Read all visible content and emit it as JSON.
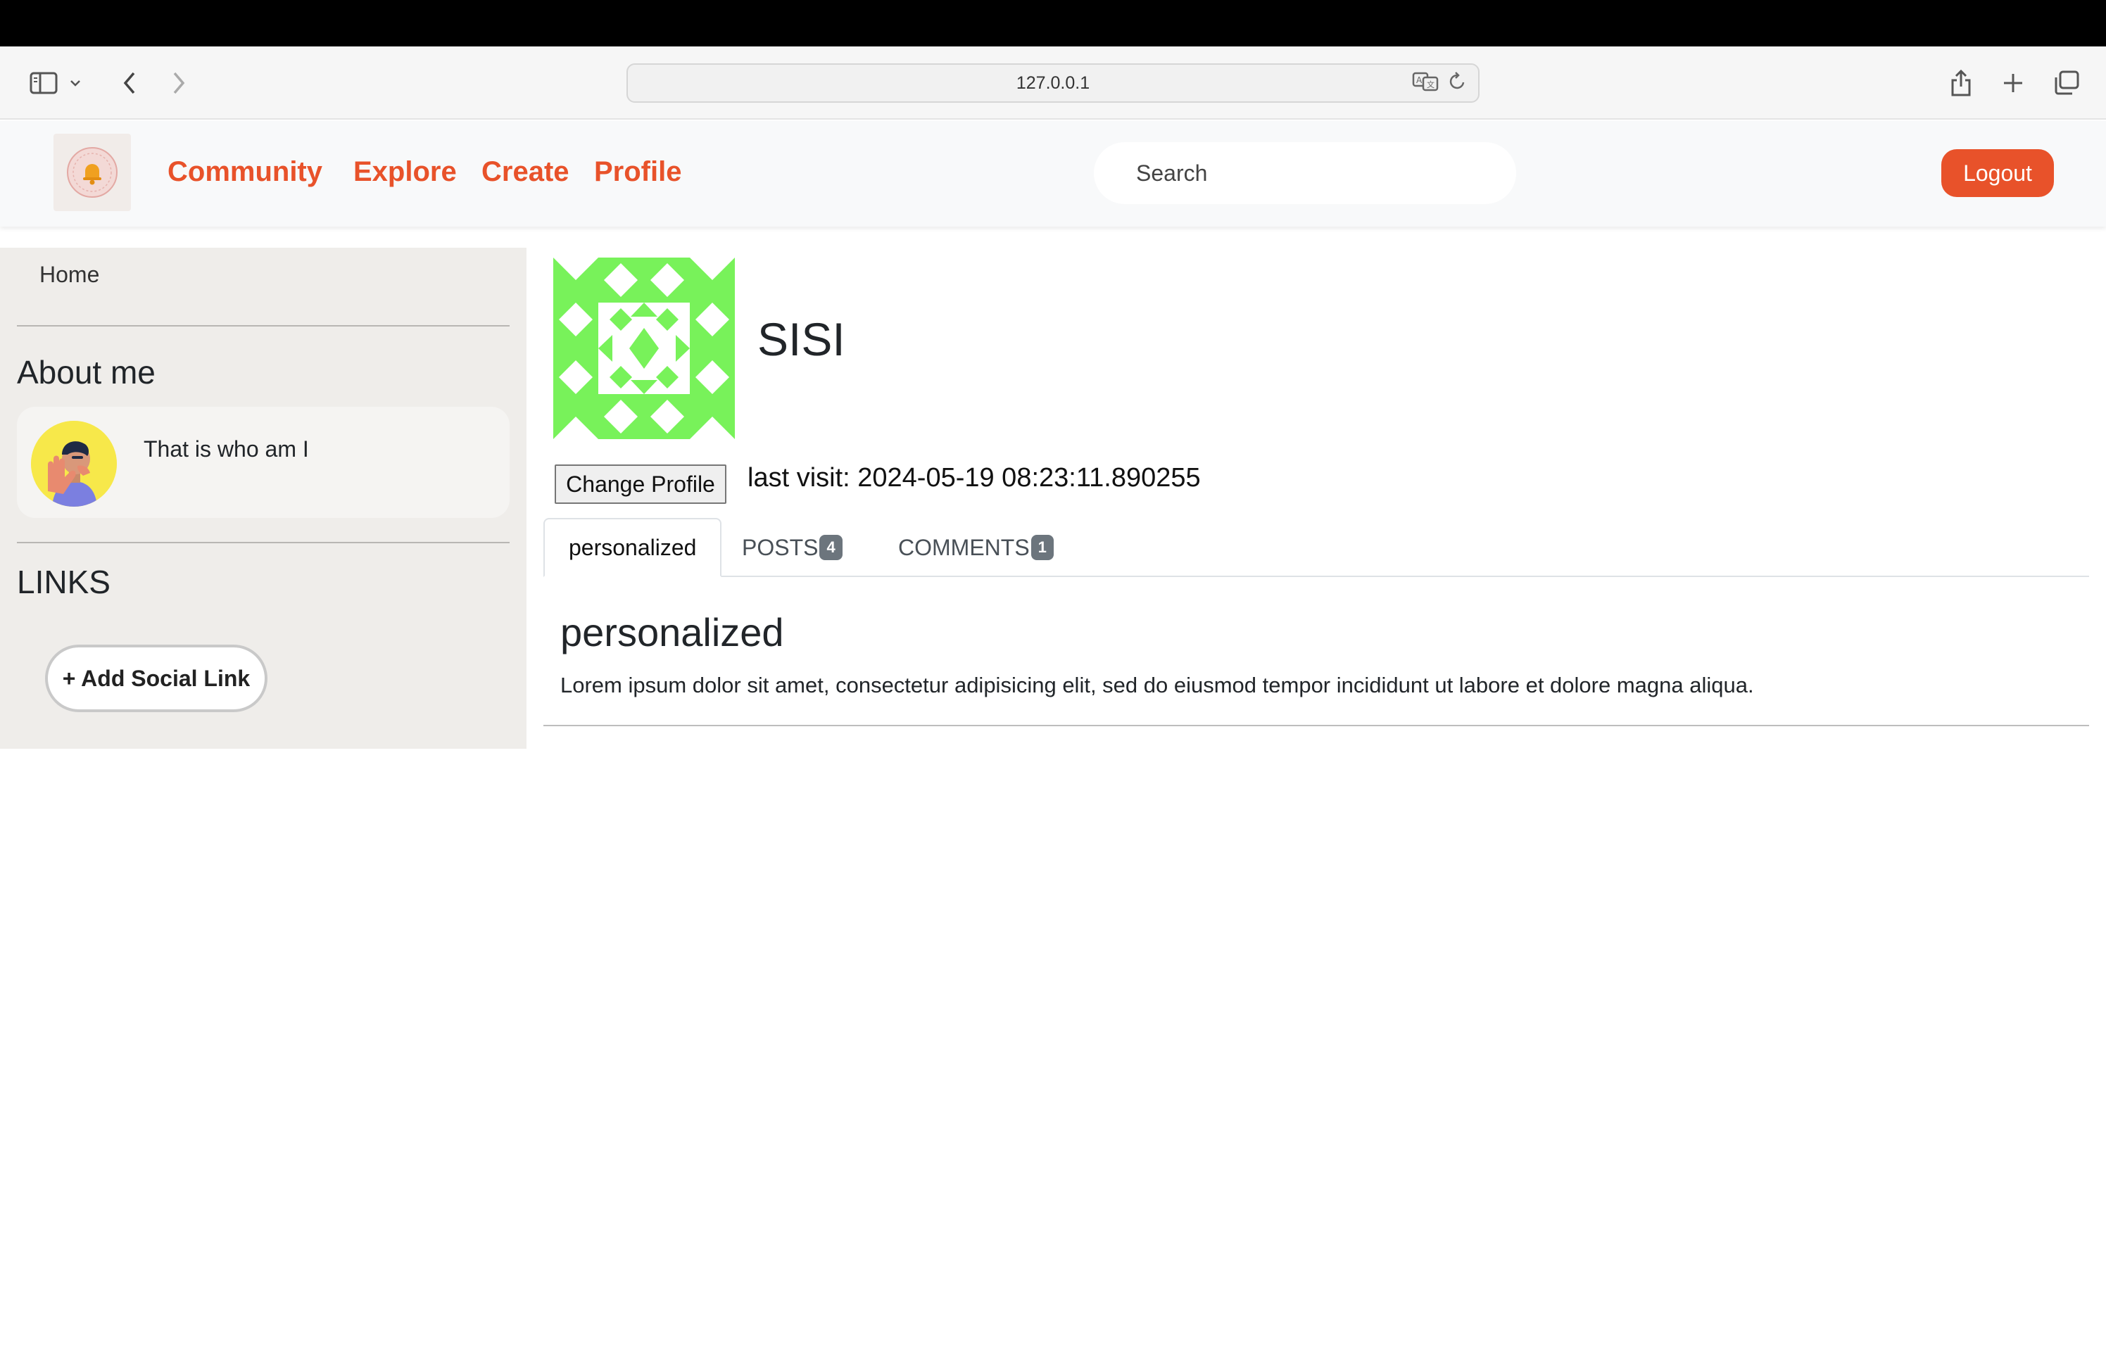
{
  "browser": {
    "url": "127.0.0.1",
    "icons": [
      "sidebar-icon",
      "chevron-down-icon",
      "back-icon",
      "forward-icon",
      "translate-icon",
      "reload-icon",
      "share-icon",
      "new-tab-icon",
      "tabs-overview-icon"
    ]
  },
  "navbar": {
    "logo_icon": "bell-logo-icon",
    "links": [
      "Community",
      "Explore",
      "Create",
      "Profile"
    ],
    "search_placeholder": "Search",
    "logout_label": "Logout",
    "accent_color": "#e8522a"
  },
  "sidebar": {
    "home": "Home",
    "about_heading": "About me",
    "about_text": "That is who am I",
    "links_heading": "LINKS",
    "add_link_label": "+ Add Social Link"
  },
  "profile": {
    "username": "SISI",
    "change_button": "Change Profile",
    "last_visit": "last visit: 2024-05-19 08:23:11.890255",
    "identicon_color": "#78f25a"
  },
  "tabs": [
    {
      "label": "personalized",
      "badge": null,
      "active": true
    },
    {
      "label": "POSTS",
      "badge": "4",
      "active": false
    },
    {
      "label": "COMMENTS",
      "badge": "1",
      "active": false
    }
  ],
  "pane": {
    "title": "personalized",
    "text": "Lorem ipsum dolor sit amet, consectetur adipisicing elit, sed do eiusmod tempor incididunt ut labore et dolore magna aliqua."
  }
}
